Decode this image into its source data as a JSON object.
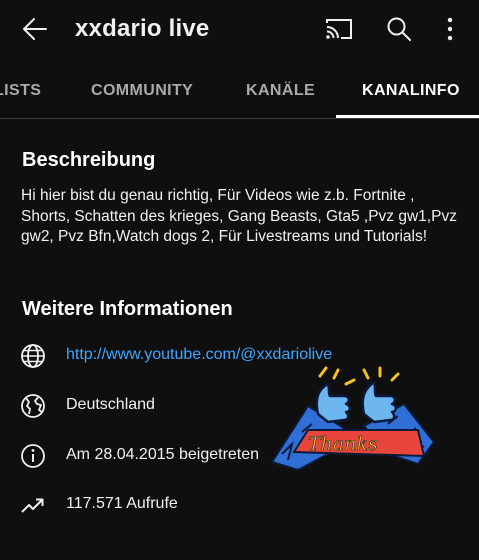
{
  "header": {
    "title": "xxdario live",
    "icons": [
      "back-arrow-icon",
      "cast-icon",
      "search-icon",
      "more-vertical-icon"
    ]
  },
  "tabs": [
    {
      "label": "LISTS",
      "active": false
    },
    {
      "label": "COMMUNITY",
      "active": false
    },
    {
      "label": "KANÄLE",
      "active": false
    },
    {
      "label": "KANALINFO",
      "active": true
    }
  ],
  "description": {
    "heading": "Beschreibung",
    "text": "Hi hier bist du genau richtig,  Für Videos wie  z.b. Fortnite , Shorts, Schatten des krieges, Gang Beasts, Gta5 ,Pvz gw1,Pvz gw2, Pvz Bfn,Watch dogs 2, Für Livestreams und Tutorials!"
  },
  "more_info": {
    "heading": "Weitere Informationen",
    "link": "http://www.youtube.com/@xxdariolive",
    "country": "Deutschland",
    "joined": "Am 28.04.2015 beigetreten",
    "views": "117.571 Aufrufe"
  },
  "sticker": {
    "text": "Thanks",
    "icon": "thumbs-up-thanks-sticker"
  },
  "colors": {
    "background": "#0f0f0f",
    "link": "#3ea6ff",
    "muted": "#aaaaaa",
    "sticker_blue": "#2f6fd6",
    "sticker_red": "#e8453c",
    "sticker_yellow": "#f6c21b",
    "sticker_light_blue": "#6eb6f0"
  }
}
